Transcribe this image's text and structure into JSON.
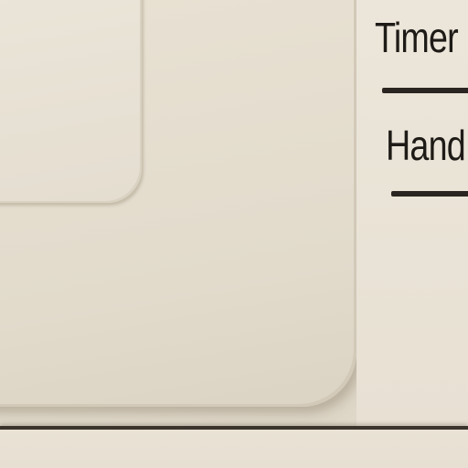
{
  "panel": {
    "labels": [
      {
        "text": "Timer"
      },
      {
        "text": "Hand"
      }
    ]
  },
  "colors": {
    "surface": "#e6dfd1",
    "text": "#1e1b17",
    "seam": "#3a342d"
  }
}
